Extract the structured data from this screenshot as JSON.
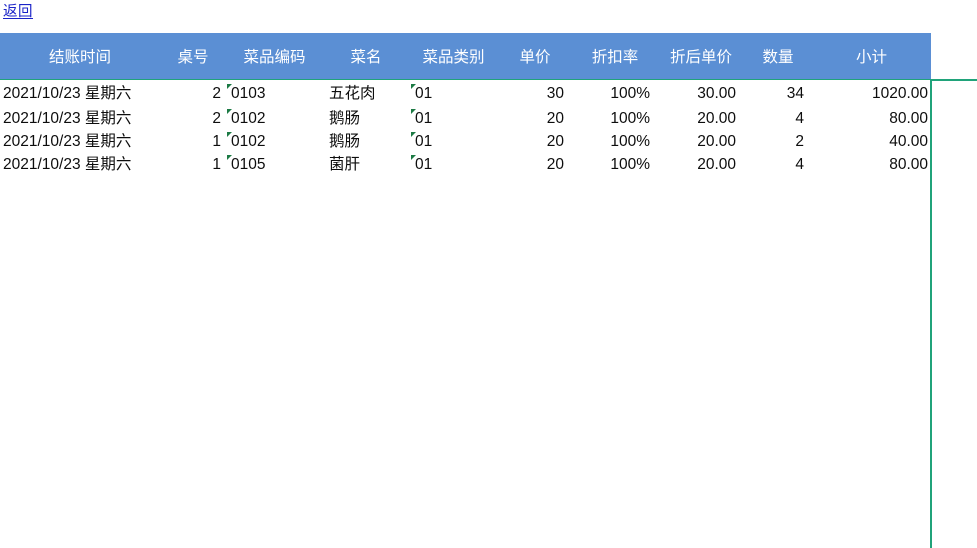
{
  "nav": {
    "back_label": "返回"
  },
  "colors": {
    "header_bg": "#5b8fd4",
    "header_text": "#ffffff",
    "grid_accent": "#20a37a",
    "link": "#1a23c8",
    "error_marker": "#1c7a44"
  },
  "table": {
    "columns": [
      {
        "key": "checkout_time",
        "label": "结账时间"
      },
      {
        "key": "table_no",
        "label": "桌号"
      },
      {
        "key": "dish_code",
        "label": "菜品编码"
      },
      {
        "key": "dish_name",
        "label": "菜名"
      },
      {
        "key": "dish_category",
        "label": "菜品类别"
      },
      {
        "key": "unit_price",
        "label": "单价"
      },
      {
        "key": "discount_rate",
        "label": "折扣率"
      },
      {
        "key": "price_after",
        "label": "折后单价"
      },
      {
        "key": "quantity",
        "label": "数量"
      },
      {
        "key": "subtotal",
        "label": "小计"
      }
    ],
    "rows": [
      {
        "checkout_time": "2021/10/23 星期六",
        "table_no": "2",
        "dish_code": "0103",
        "dish_name": "五花肉",
        "dish_category": "01",
        "unit_price": "30",
        "discount_rate": "100%",
        "price_after": "30.00",
        "quantity": "34",
        "subtotal": "1020.00"
      },
      {
        "checkout_time": "2021/10/23 星期六",
        "table_no": "2",
        "dish_code": "0102",
        "dish_name": "鹅肠",
        "dish_category": "01",
        "unit_price": "20",
        "discount_rate": "100%",
        "price_after": "20.00",
        "quantity": "4",
        "subtotal": "80.00"
      },
      {
        "checkout_time": "2021/10/23 星期六",
        "table_no": "1",
        "dish_code": "0102",
        "dish_name": "鹅肠",
        "dish_category": "01",
        "unit_price": "20",
        "discount_rate": "100%",
        "price_after": "20.00",
        "quantity": "2",
        "subtotal": "40.00"
      },
      {
        "checkout_time": "2021/10/23 星期六",
        "table_no": "1",
        "dish_code": "0105",
        "dish_name": "菌肝",
        "dish_category": "01",
        "unit_price": "20",
        "discount_rate": "100%",
        "price_after": "20.00",
        "quantity": "4",
        "subtotal": "80.00"
      }
    ]
  }
}
